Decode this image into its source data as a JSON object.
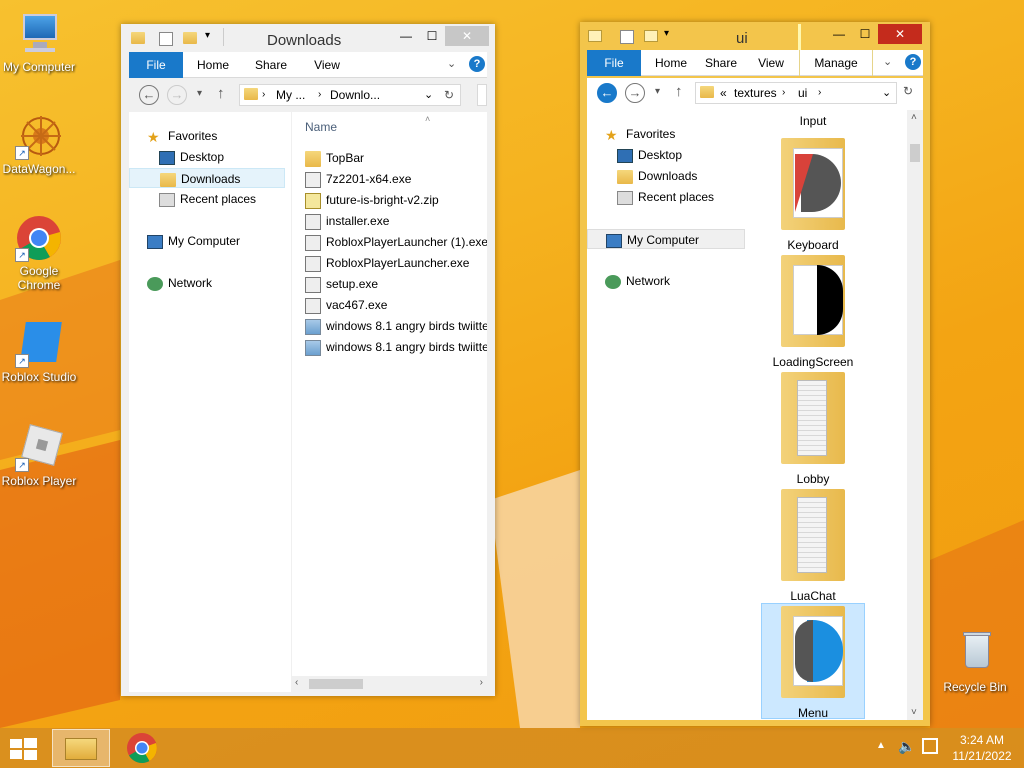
{
  "desktop": {
    "icons": [
      {
        "label": "My Computer"
      },
      {
        "label": "DataWagon..."
      },
      {
        "label": "Google Chrome"
      },
      {
        "label": "Roblox Studio"
      },
      {
        "label": "Roblox Player"
      }
    ],
    "recycle_bin": "Recycle Bin"
  },
  "downloads_window": {
    "title": "Downloads",
    "tabs": [
      "File",
      "Home",
      "Share",
      "View"
    ],
    "address": {
      "part1": "My ...",
      "part2": "Downlo..."
    },
    "nav": {
      "favorites": "Favorites",
      "desktop": "Desktop",
      "downloads": "Downloads",
      "recent": "Recent places",
      "computer": "My Computer",
      "network": "Network"
    },
    "column_header": "Name",
    "files": [
      {
        "name": "TopBar",
        "icon": "folder-icon"
      },
      {
        "name": "7z2201-x64.exe",
        "icon": "exe-icon"
      },
      {
        "name": "future-is-bright-v2.zip",
        "icon": "zip-icon"
      },
      {
        "name": "installer.exe",
        "icon": "exe-icon"
      },
      {
        "name": "RobloxPlayerLauncher (1).exe",
        "icon": "exe-icon"
      },
      {
        "name": "RobloxPlayerLauncher.exe",
        "icon": "exe-icon"
      },
      {
        "name": "setup.exe",
        "icon": "exe-icon"
      },
      {
        "name": "vac467.exe",
        "icon": "exe-icon"
      },
      {
        "name": "windows 8.1 angry birds twiitte",
        "icon": "image-icon"
      },
      {
        "name": "windows 8.1 angry birds twiitte",
        "icon": "image-icon"
      }
    ]
  },
  "ui_window": {
    "title": "ui",
    "tabs": [
      "File",
      "Home",
      "Share",
      "View",
      "Manage"
    ],
    "address": {
      "prefix": "«",
      "part1": "textures",
      "part2": "ui"
    },
    "nav": {
      "favorites": "Favorites",
      "desktop": "Desktop",
      "downloads": "Downloads",
      "recent": "Recent places",
      "computer": "My Computer",
      "network": "Network"
    },
    "folders": [
      {
        "name": "Input"
      },
      {
        "name": "Keyboard"
      },
      {
        "name": "LoadingScreen"
      },
      {
        "name": "Lobby"
      },
      {
        "name": "LuaChat"
      },
      {
        "name": "Menu"
      }
    ]
  },
  "taskbar": {
    "time": "3:24 AM",
    "date": "11/21/2022"
  }
}
